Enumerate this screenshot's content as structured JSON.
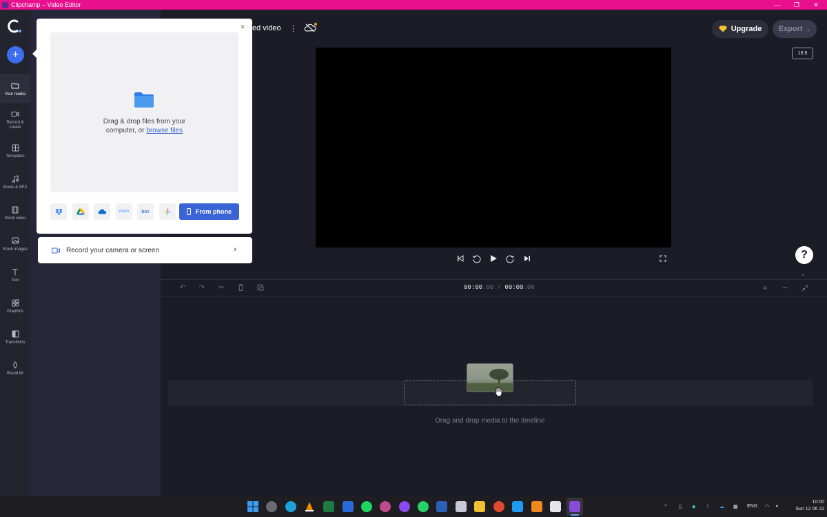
{
  "window": {
    "title": "Clipchamp – Video Editor"
  },
  "rail": {
    "items": [
      {
        "label": "Your media",
        "icon": "folder-icon"
      },
      {
        "label": "Record & create",
        "icon": "video-camera-icon"
      },
      {
        "label": "Templates",
        "icon": "templates-icon"
      },
      {
        "label": "Music & SFX",
        "icon": "music-note-icon"
      },
      {
        "label": "Stock video",
        "icon": "film-icon"
      },
      {
        "label": "Stock images",
        "icon": "image-icon"
      },
      {
        "label": "Text",
        "icon": "text-icon"
      },
      {
        "label": "Graphics",
        "icon": "shapes-icon"
      },
      {
        "label": "Transitions",
        "icon": "transitions-icon"
      },
      {
        "label": "Brand kit",
        "icon": "brand-kit-icon"
      }
    ]
  },
  "import_popup": {
    "drop_text_1": "Drag & drop files from your",
    "drop_text_2": "computer, or",
    "browse_link": "browse files",
    "sources": [
      {
        "name": "dropbox-icon",
        "label": ""
      },
      {
        "name": "google-drive-icon",
        "label": ""
      },
      {
        "name": "onedrive-icon",
        "label": ""
      },
      {
        "name": "zoom-icon",
        "label": "zoom"
      },
      {
        "name": "box-icon",
        "label": "box"
      },
      {
        "name": "google-photos-icon",
        "label": ""
      }
    ],
    "from_phone": "From phone",
    "record_text": "Record your camera or screen"
  },
  "header": {
    "project_title": "ed video",
    "upgrade": "Upgrade",
    "export": "Export"
  },
  "preview": {
    "aspect_ratio": "16:9"
  },
  "timeline": {
    "time_current": "00:00",
    "time_current_frac": ".00",
    "separator": " / ",
    "time_total": "00:00",
    "time_total_frac": ".00",
    "drop_hint": "Drag and drop media to the timeline"
  },
  "taskbar": {
    "lang": "ENG",
    "time": "10:00",
    "date": "Sun 12 06 22"
  },
  "colors": {
    "accent": "#3d6ef0",
    "titlebar": "#e8108c",
    "background": "#1c1c26"
  }
}
